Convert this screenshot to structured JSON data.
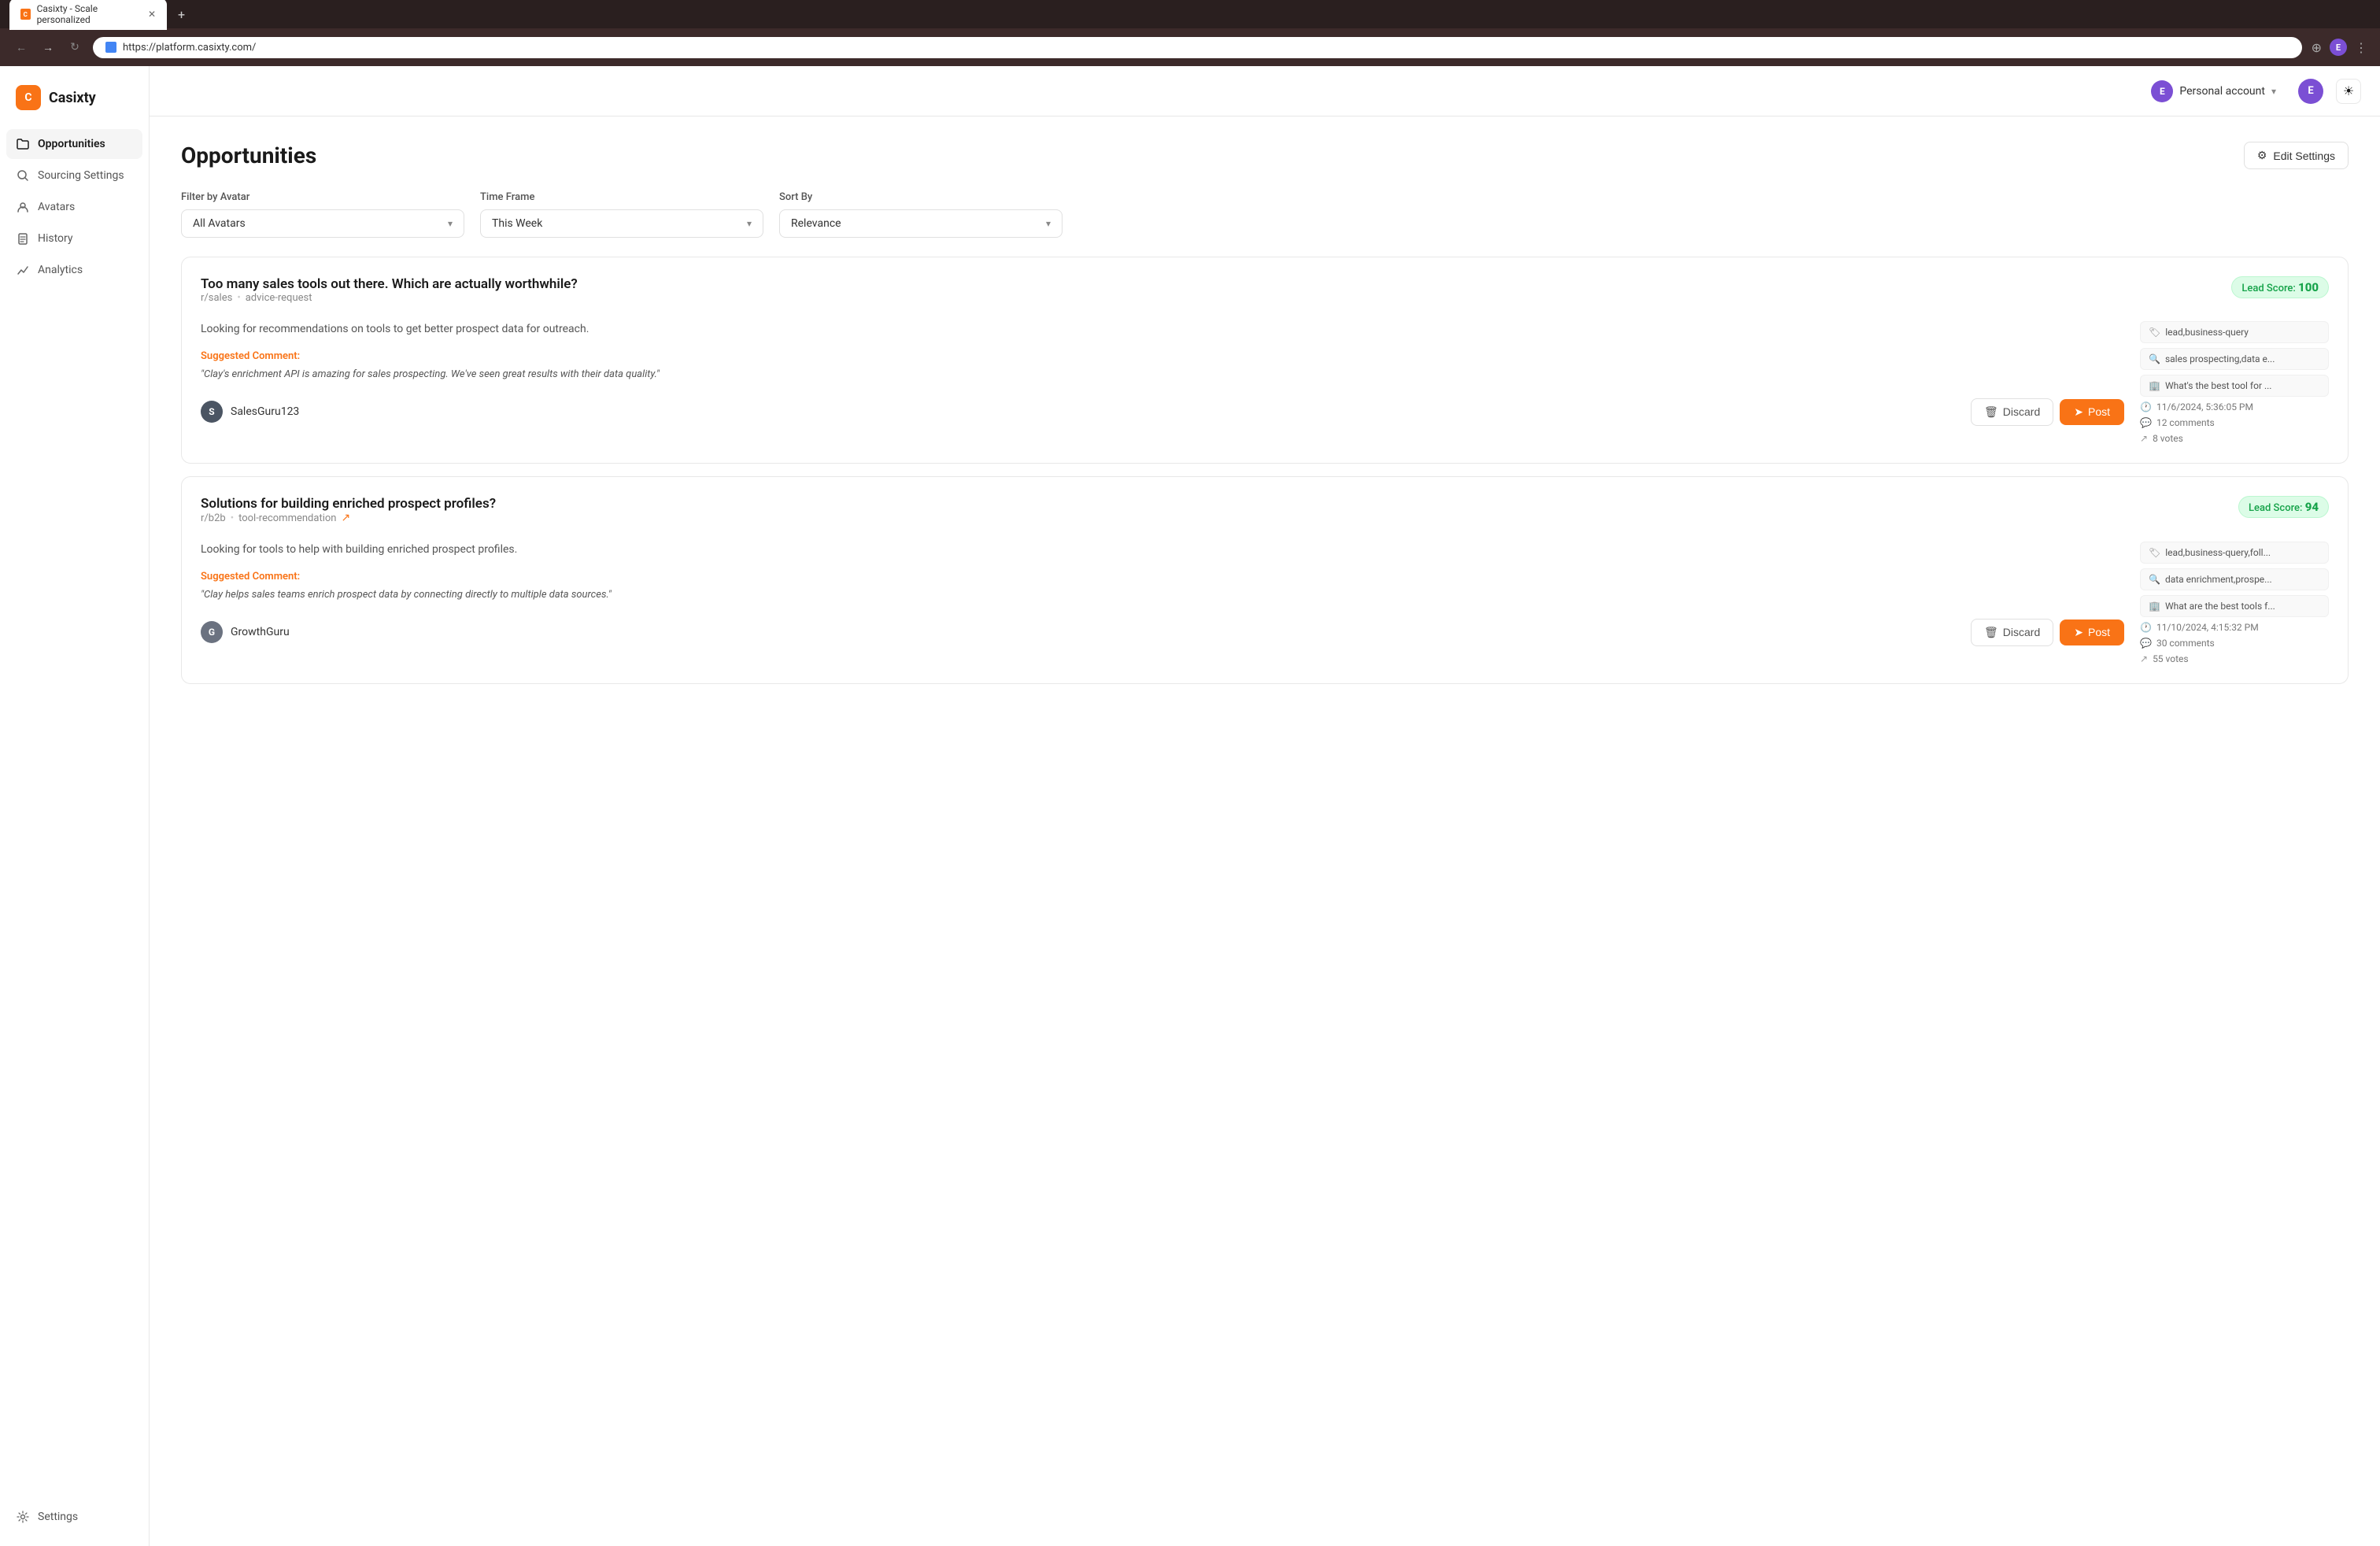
{
  "browser": {
    "tab_title": "Casixty - Scale personalized",
    "url": "https://platform.casixty.com/",
    "new_tab_label": "+"
  },
  "header": {
    "logo_text": "Casixty",
    "account_name": "Personal account",
    "avatar_letter": "E",
    "theme_icon": "☀"
  },
  "sidebar": {
    "items": [
      {
        "id": "opportunities",
        "label": "Opportunities",
        "icon": "folder",
        "active": true
      },
      {
        "id": "sourcing-settings",
        "label": "Sourcing Settings",
        "icon": "search-circle"
      },
      {
        "id": "avatars",
        "label": "Avatars",
        "icon": "user"
      },
      {
        "id": "history",
        "label": "History",
        "icon": "file"
      },
      {
        "id": "analytics",
        "label": "Analytics",
        "icon": "chart"
      }
    ],
    "bottom_items": [
      {
        "id": "settings",
        "label": "Settings",
        "icon": "gear"
      }
    ]
  },
  "page": {
    "title": "Opportunities",
    "edit_settings_label": "Edit Settings"
  },
  "filters": {
    "avatar_label": "Filter by Avatar",
    "avatar_value": "All Avatars",
    "timeframe_label": "Time Frame",
    "timeframe_value": "This Week",
    "sortby_label": "Sort By",
    "sortby_value": "Relevance"
  },
  "opportunities": [
    {
      "id": 1,
      "title": "Too many sales tools out there. Which are actually worthwhile?",
      "subreddit": "r/sales",
      "tag": "advice-request",
      "lead_score": 100,
      "description": "Looking for recommendations on tools to get better prospect data for outreach.",
      "suggested_label": "Suggested Comment:",
      "suggested_comment": "\"Clay's enrichment API is amazing for sales prospecting. We've seen great results with their data quality.\"",
      "avatar_letter": "S",
      "avatar_name": "SalesGuru123",
      "tags_right": [
        {
          "icon": "tag",
          "text": "lead,business-query"
        },
        {
          "icon": "search",
          "text": "sales prospecting,data e..."
        },
        {
          "icon": "building",
          "text": "What's the best tool for ..."
        }
      ],
      "timestamp": "11/6/2024, 5:36:05 PM",
      "comments": "12 comments",
      "votes": "8 votes",
      "discard_label": "Discard",
      "post_label": "Post"
    },
    {
      "id": 2,
      "title": "Solutions for building enriched prospect profiles?",
      "subreddit": "r/b2b",
      "tag": "tool-recommendation",
      "has_trend": true,
      "lead_score": 94,
      "description": "Looking for tools to help with building enriched prospect profiles.",
      "suggested_label": "Suggested Comment:",
      "suggested_comment": "\"Clay helps sales teams enrich prospect data by connecting directly to multiple data sources.\"",
      "avatar_letter": "G",
      "avatar_name": "GrowthGuru",
      "tags_right": [
        {
          "icon": "tag",
          "text": "lead,business-query,foll..."
        },
        {
          "icon": "search",
          "text": "data enrichment,prospe..."
        },
        {
          "icon": "building",
          "text": "What are the best tools f..."
        }
      ],
      "timestamp": "11/10/2024, 4:15:32 PM",
      "comments": "30 comments",
      "votes": "55 votes",
      "discard_label": "Discard",
      "post_label": "Post"
    }
  ]
}
